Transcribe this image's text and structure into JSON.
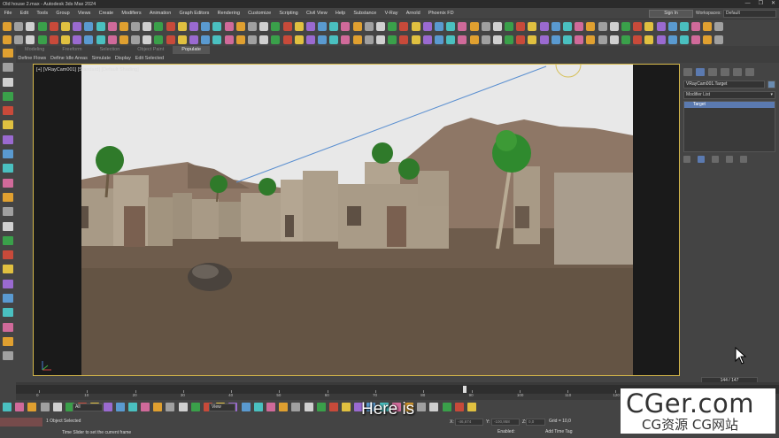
{
  "window": {
    "title": "Old house 2.max - Autodesk 3ds Max 2024",
    "controls": [
      "—",
      "❐",
      "✕"
    ]
  },
  "menubar": {
    "items": [
      "File",
      "Edit",
      "Tools",
      "Group",
      "Views",
      "Create",
      "Modifiers",
      "Animation",
      "Graph Editors",
      "Rendering",
      "Customize",
      "Scripting",
      "Civil View",
      "Help",
      "Substance",
      "V-Ray",
      "Arnold",
      "Phoenix FD"
    ],
    "sign_in": "Sign In",
    "workspaces_label": "Workspaces:",
    "workspaces_value": "Default"
  },
  "ribbon": {
    "tabs": [
      "Modeling",
      "Freeform",
      "Selection",
      "Object Paint",
      "Populate"
    ],
    "active_tab": "Populate",
    "subitems": [
      "Define Flows",
      "Define Idle Areas",
      "Simulate",
      "Display",
      "Edit Selected"
    ]
  },
  "viewport": {
    "label": "[+] [VRayCam001] [Standard] [Default Shading]",
    "axis_labels": [
      "x",
      "y",
      "z"
    ]
  },
  "command_panel": {
    "object_name": "VRayCam001.Target",
    "modifier_list": "Modifier List",
    "stack_item": "Target",
    "frame_counter": "144 / 147"
  },
  "timeline": {
    "current_frame_fraction": 0.5856,
    "tick_labels": [
      "0",
      "10",
      "20",
      "30",
      "40",
      "50",
      "60",
      "70",
      "80",
      "90",
      "100",
      "110",
      "120",
      "130",
      "140"
    ]
  },
  "bottom_bar": {
    "selection_filter": "All",
    "view_dropdown": "View",
    "status_selected": "1 Object Selected",
    "status_hint": "Click or click-and-drag to select objects",
    "slider_hint": "Time Slider to set the current frame",
    "x_label": "X:",
    "x_value": "-46,674",
    "y_label": "Y:",
    "y_value": "-100,958",
    "z_label": "Z:",
    "z_value": "0,0",
    "grid": "Grid = 10,0",
    "enabled": "Enabled:",
    "add_time_tag": "Add Time Tag"
  },
  "subtitle": "Here is",
  "watermark": {
    "line1": "CGer.com",
    "line2": "CG资源 CG网站"
  },
  "colors": {
    "viewport_border": "#d6b84a",
    "selection_blue": "#5b7ab0",
    "sky": "#e8e8e8",
    "ground": "#6e5c4c",
    "buildings": "#a89a86",
    "mountains": "#8e7766"
  }
}
